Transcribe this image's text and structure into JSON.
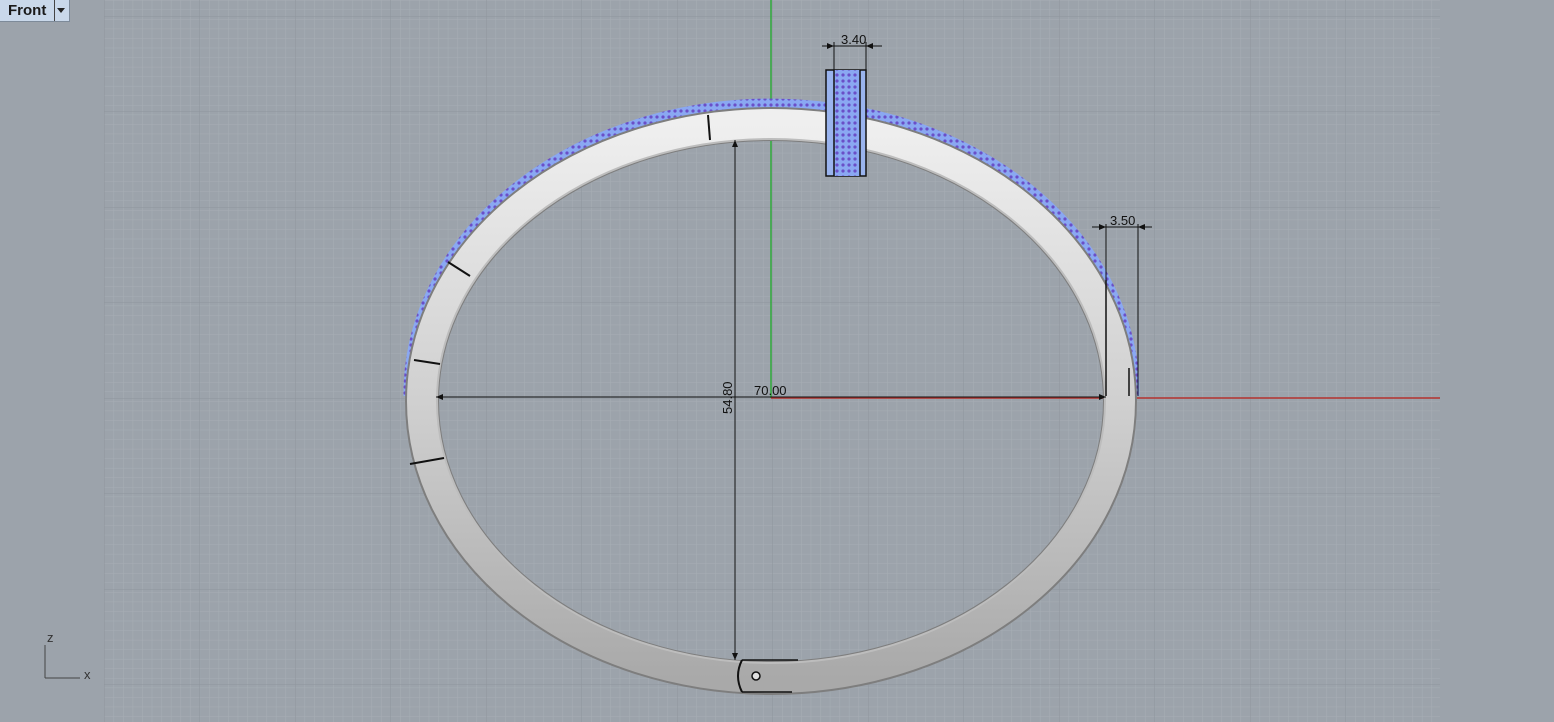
{
  "viewport": {
    "name": "Front",
    "dropdown_icon": "triangle-down-icon"
  },
  "dimensions": {
    "top_width": "3.40",
    "side_width": "3.50",
    "horizontal": "70.00",
    "vertical": "54.80"
  },
  "axes": {
    "z": "z",
    "x": "x"
  },
  "colors": {
    "background": "#9ca3ab",
    "grid_minor": "#a7aeb5",
    "grid_major": "#8e959c",
    "x_axis": "#b3322e",
    "z_axis": "#2faa3a",
    "ring": "#d4d4d4",
    "gem": "#8aa8f2",
    "gem_dot": "#6a4fc8"
  }
}
